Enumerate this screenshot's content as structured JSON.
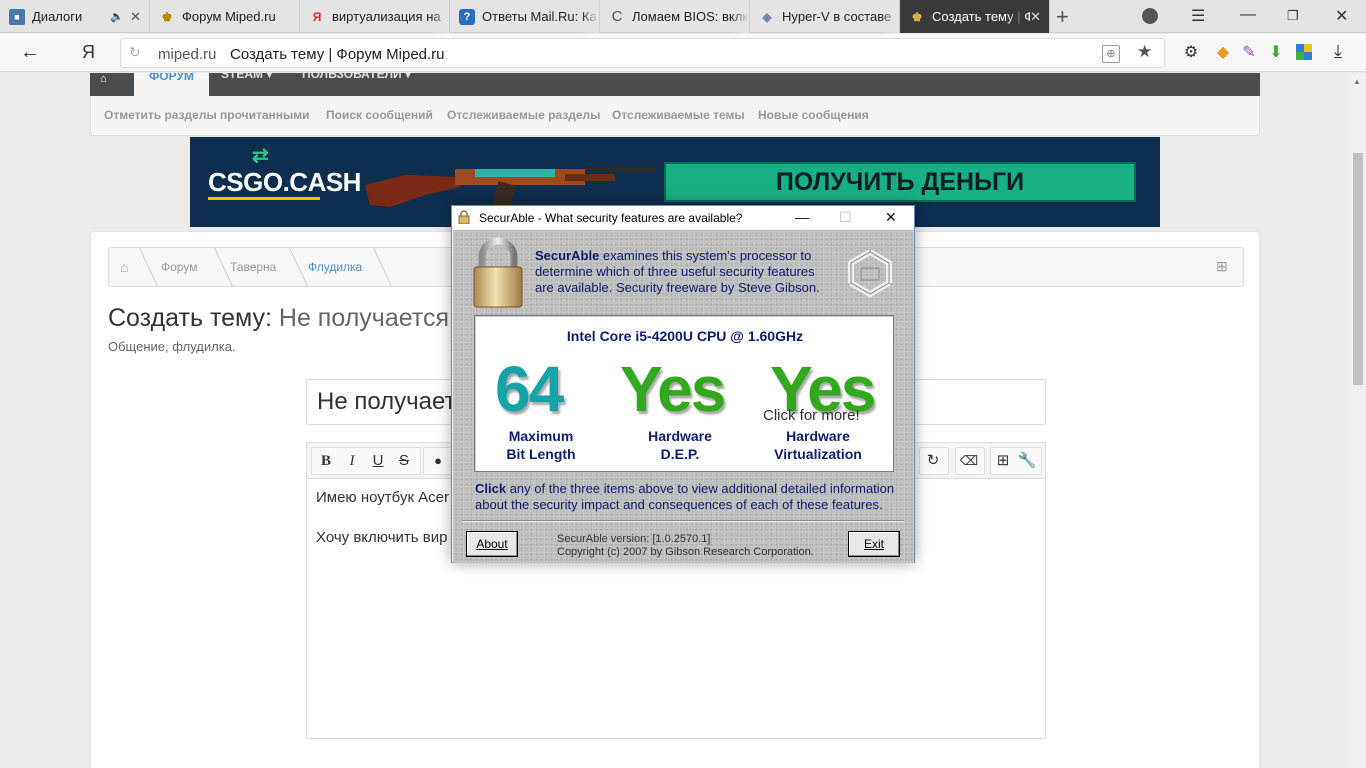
{
  "tabs": [
    {
      "title": "Диалоги",
      "fav": "vk-icon"
    },
    {
      "title": "Форум Miped.ru",
      "fav": "miped-icon"
    },
    {
      "title": "виртуализация на",
      "fav": "yandex-icon"
    },
    {
      "title": "Ответы Mail.Ru: Ка",
      "fav": "mailru-icon"
    },
    {
      "title": "Ломаем BIOS: вклк",
      "fav": "loading-icon"
    },
    {
      "title": "Hyper-V в составе",
      "fav": "hyperv-icon"
    },
    {
      "title": "Создать тему | Ф",
      "fav": "miped-icon"
    }
  ],
  "address": {
    "domain": "miped.ru",
    "page_title": "Создать тему | Форум Miped.ru"
  },
  "forum_nav": {
    "active": "ФОРУМ",
    "steam": "STEAM",
    "users": "ПОЛЬЗОВАТЕЛИ"
  },
  "subnav": [
    "Отметить разделы прочитанными",
    "Поиск сообщений",
    "Отслеживаемые разделы",
    "Отслеживаемые темы",
    "Новые сообщения"
  ],
  "banner": {
    "logo": "CSGO.CASH",
    "cta": "ПОЛУЧИТЬ ДЕНЬГИ"
  },
  "breadcrumbs": [
    "Форум",
    "Таверна",
    "Флудилка"
  ],
  "page": {
    "heading_prefix": "Создать тему:",
    "heading_thread": "Не получается",
    "subtitle": "Общение, флудилка.",
    "title_input_value": "Не получает",
    "editor_line1": "Имею ноутбук Acer",
    "editor_line2": "Хочу включить вир"
  },
  "dialog": {
    "title": "SecurAble - What security features are available?",
    "intro_brand": "SecurAble",
    "intro_rest": " examines this system's processor to determine which of three useful security features are available.  Security freeware by Steve Gibson.",
    "cpu": "Intel Core i5-4200U CPU @ 1.60GHz",
    "bitlength_value": "64",
    "dep_value": "Yes",
    "virt_value": "Yes",
    "click_more": "Click for more!",
    "label_bits_1": "Maximum",
    "label_bits_2": "Bit Length",
    "label_dep_1": "Hardware",
    "label_dep_2": "D.E.P.",
    "label_virt_1": "Hardware",
    "label_virt_2": "Virtualization",
    "hint_bold": "Click",
    "hint_rest": " any of the three items above to view additional detailed information about the security impact and consequences of each of these features.",
    "about_label": "About",
    "exit_label": "Exit",
    "version": "SecurAble version: [1.0.2570.1]",
    "copyright": "Copyright (c) 2007 by Gibson Research Corporation."
  },
  "colors": {
    "banner_bg": "#0d2e4e",
    "cta_green": "#17b082",
    "yes_green": "#32a81c",
    "bits_teal": "#14a3a8",
    "dialog_text_navy": "#0e1c6e",
    "active_tab": "#3a3a3a"
  }
}
